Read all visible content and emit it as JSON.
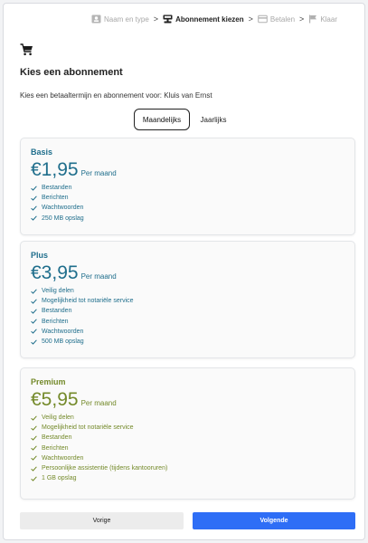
{
  "stepper": {
    "steps": [
      {
        "label": "Naam en type",
        "state": "done",
        "icon": "id-card-icon"
      },
      {
        "label": "Abonnement kiezen",
        "state": "active",
        "icon": "register-icon"
      },
      {
        "label": "Betalen",
        "state": "upcoming",
        "icon": "credit-card-icon"
      },
      {
        "label": "Klaar",
        "state": "upcoming",
        "icon": "flag-icon"
      }
    ],
    "separator": ">"
  },
  "header": {
    "icon": "cart-icon",
    "title": "Kies een abonnement",
    "subtitle": "Kies een betaaltermijn en abonnement voor: Kluis van Ernst"
  },
  "billing_toggle": {
    "options": [
      "Maandelijks",
      "Jaarlijks"
    ],
    "selected": "Maandelijks"
  },
  "plans": [
    {
      "name": "Basis",
      "price": "€1,95",
      "period": "Per maand",
      "color": "#1f6e8c",
      "features": [
        "Bestanden",
        "Berichten",
        "Wachtwoorden",
        "250 MB opslag"
      ]
    },
    {
      "name": "Plus",
      "price": "€3,95",
      "period": "Per maand",
      "color": "#1f6e8c",
      "features": [
        "Veilig delen",
        "Mogelijkheid tot notariële service",
        "Bestanden",
        "Berichten",
        "Wachtwoorden",
        "500 MB opslag"
      ]
    },
    {
      "name": "Premium",
      "price": "€5,95",
      "period": "Per maand",
      "color": "#748a2a",
      "features": [
        "Veilig delen",
        "Mogelijkheid tot notariële service",
        "Bestanden",
        "Berichten",
        "Wachtwoorden",
        "Persoonlijke assistentie (tijdens kantooruren)",
        "1 GB opslag"
      ]
    }
  ],
  "actions": {
    "previous_label": "Vorige",
    "next_label": "Volgende",
    "next_color": "#2e6ef6"
  }
}
